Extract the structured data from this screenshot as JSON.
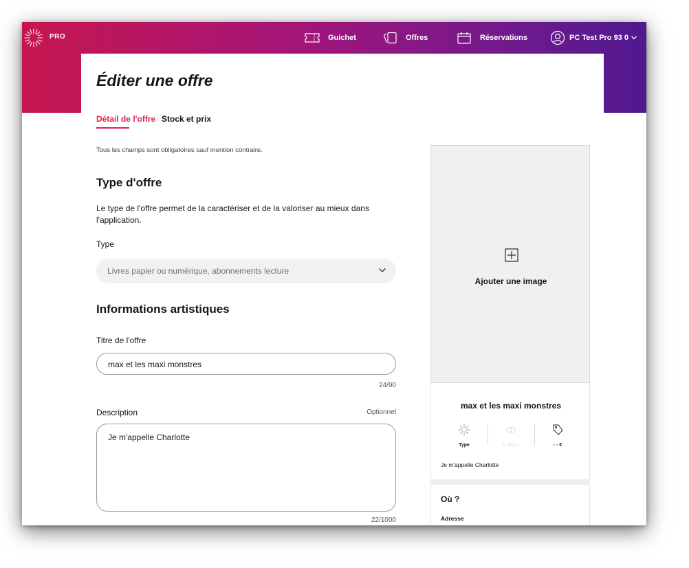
{
  "header": {
    "logo_text": "PRO",
    "nav": [
      {
        "label": "Guichet",
        "icon": "ticket-icon"
      },
      {
        "label": "Offres",
        "icon": "offers-icon"
      },
      {
        "label": "Réservations",
        "icon": "calendar-icon"
      }
    ],
    "user": {
      "label": "PC Test Pro 93 0",
      "icon": "user-avatar-icon"
    }
  },
  "page": {
    "title": "Éditer une offre",
    "tabs": [
      {
        "label": "Détail de l'offre",
        "active": true
      },
      {
        "label": "Stock et prix",
        "active": false
      }
    ],
    "hint": "Tous les champs sont obligatoires sauf mention contraire."
  },
  "type_section": {
    "title": "Type d'offre",
    "description": "Le type de l'offre permet de la caractériser et de la valoriser au mieux dans l'application.",
    "type_label": "Type",
    "type_value": "Livres papier ou numérique, abonnements lecture"
  },
  "artistic_section": {
    "title": "Informations artistiques",
    "title_label": "Titre de l'offre",
    "title_value": "max et les maxi monstres",
    "title_counter": "24/90",
    "description_label": "Description",
    "description_optional": "Optionnel",
    "description_value": "Je m'appelle Charlotte",
    "description_counter": "22/1000"
  },
  "preview": {
    "add_image_label": "Ajouter une image",
    "title": "max et les maxi monstres",
    "meta_type_label": "Type",
    "meta_duo_label": "À deux !",
    "meta_price": "- - €",
    "description": "Je m'appelle Charlotte",
    "where_title": "Où ?",
    "address_label": "Adresse"
  },
  "colors": {
    "accent": "#e3204c",
    "header_start": "#c6164f",
    "header_end": "#50198f"
  }
}
